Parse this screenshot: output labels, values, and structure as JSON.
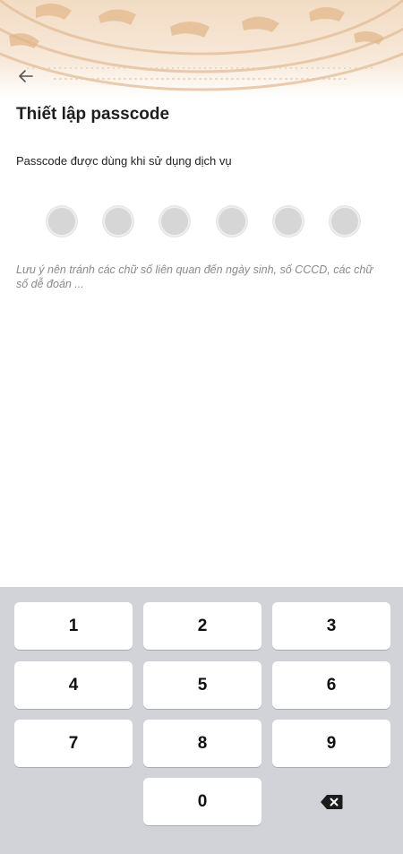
{
  "header": {
    "back_icon": "arrow-left-icon",
    "decoration": "bronze-drum-pattern"
  },
  "main": {
    "title": "Thiết lập passcode",
    "subtitle": "Passcode được dùng khi sử dụng dịch vụ",
    "pin_length": 6,
    "pin_filled": 0,
    "note": "Lưu ý nên tránh các chữ số liên quan đến ngày sinh, số CCCD, các chữ số dễ đoán ..."
  },
  "keypad": {
    "keys": [
      "1",
      "2",
      "3",
      "4",
      "5",
      "6",
      "7",
      "8",
      "9",
      "",
      "0",
      "⌫"
    ],
    "delete_icon": "backspace-icon"
  },
  "colors": {
    "keypad_bg": "#d1d3d9",
    "dot_empty": "#d6d6d6",
    "note_text": "#8a8a8a"
  }
}
